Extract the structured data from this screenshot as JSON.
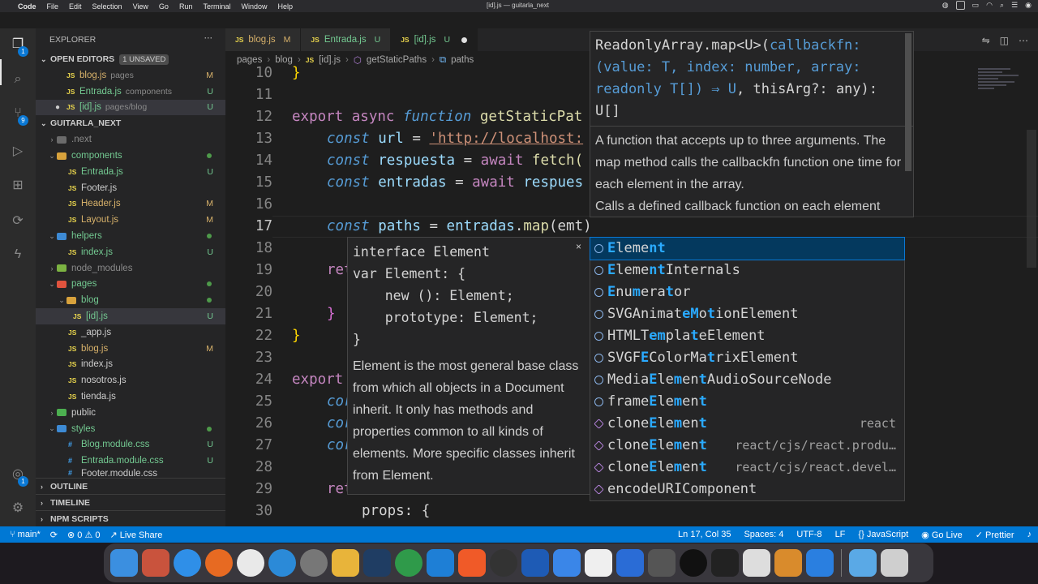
{
  "menubar": {
    "app": "Code",
    "items": [
      "File",
      "Edit",
      "Selection",
      "View",
      "Go",
      "Run",
      "Terminal",
      "Window",
      "Help"
    ],
    "window_title": "[id].js — guitarla_next"
  },
  "activity": {
    "source_control_badge": "9",
    "accounts_badge": "1",
    "explorer_badge": "1"
  },
  "sidebar": {
    "title": "EXPLORER",
    "open_editors": {
      "label": "OPEN EDITORS",
      "badge": "1 UNSAVED"
    },
    "open_files": [
      {
        "name": "blog.js",
        "path": "pages",
        "status": "M"
      },
      {
        "name": "Entrada.js",
        "path": "components",
        "status": "U"
      },
      {
        "name": "[id].js",
        "path": "pages/blog",
        "status": "U"
      }
    ],
    "project": "GUITARLA_NEXT",
    "tree": {
      "next": ".next",
      "components": "components",
      "entrada": "Entrada.js",
      "footer": "Footer.js",
      "header": "Header.js",
      "layout": "Layout.js",
      "helpers": "helpers",
      "index_helpers": "index.js",
      "node_modules": "node_modules",
      "pages": "pages",
      "blog_folder": "blog",
      "id_js": "[id].js",
      "app_js": "_app.js",
      "blog_js": "blog.js",
      "index_js": "index.js",
      "nosotros": "nosotros.js",
      "tienda": "tienda.js",
      "public": "public",
      "styles": "styles",
      "blog_css": "Blog.module.css",
      "entrada_css": "Entrada.module.css",
      "footer_css": "Footer.module.css"
    },
    "status": {
      "u": "U",
      "m": "M"
    },
    "outline": "OUTLINE",
    "timeline": "TIMELINE",
    "npm": "NPM SCRIPTS"
  },
  "tabs": [
    {
      "label": "blog.js",
      "status": "M"
    },
    {
      "label": "Entrada.js",
      "status": "U"
    },
    {
      "label": "[id].js",
      "status": "U"
    }
  ],
  "breadcrumbs": {
    "a": "pages",
    "b": "blog",
    "c": "[id].js",
    "d": "getStaticPaths",
    "e": "paths"
  },
  "editor": {
    "line_numbers": [
      "10",
      "11",
      "12",
      "13",
      "14",
      "15",
      "16",
      "17",
      "18",
      "19",
      "20",
      "21",
      "22",
      "23",
      "24",
      "25",
      "26",
      "27",
      "28",
      "29",
      "30"
    ],
    "current_line": "17",
    "l12": {
      "kw1": "export",
      "kw2": "async",
      "kw3": "function",
      "fn": "getStaticPat"
    },
    "l13": {
      "kw": "const",
      "var": "url",
      "op": " = ",
      "str": "'http://localhost:"
    },
    "l14": {
      "kw": "const",
      "var": "respuesta",
      "op": " = ",
      "kw2": "await",
      "fn": "fetch("
    },
    "l15": {
      "kw": "const",
      "var": "entradas",
      "op": " = ",
      "kw2": "await",
      "var2": "respues"
    },
    "l17": {
      "kw": "const",
      "var": "paths",
      "op": " = ",
      "var2": "entradas",
      "dot": ".",
      "fn": "map",
      "rest": "(emt)"
    },
    "l19": {
      "kw": "ret"
    },
    "l21": {
      "brace": "}"
    },
    "l22": {
      "brace": "}"
    },
    "l24": {
      "kw": "export"
    },
    "l25": {
      "kw": "cor"
    },
    "l26": {
      "kw": "cor"
    },
    "l27": {
      "kw": "cor"
    },
    "l29": {
      "kw": "ret"
    },
    "l30": {
      "code": "props: {"
    },
    "l10": {
      "brace": "}"
    }
  },
  "signature_hover": {
    "code_line1": "ReadonlyArray.map<U>(",
    "code_param1": "callbackfn:",
    "code_param2": "(value: T, index: number, array:",
    "code_param3": "readonly T[]) ⇒ U",
    "code_rest": ", thisArg?: any):",
    "code_line4": "U[]",
    "doc1": "A function that accepts up to three arguments. The map method calls the callbackfn function one time for each element in the array.",
    "doc2": "Calls a defined callback function on each element"
  },
  "detail_hover": {
    "code": "interface Element\nvar Element: {\n    new (): Element;\n    prototype: Element;\n}",
    "doc": "Element is the most general base class from which all objects in a Document inherit. It only has methods and properties common to all kinds of elements. More specific classes inherit from Element.",
    "close": "×"
  },
  "suggestions": [
    {
      "parts": [
        [
          "E",
          "hl"
        ],
        [
          "l",
          ""
        ],
        [
          "e",
          ""
        ],
        [
          "m",
          ""
        ],
        [
          "e",
          ""
        ],
        [
          "nt",
          "hl"
        ]
      ],
      "detail": "",
      "icon": "class"
    },
    {
      "parts": [
        [
          "E",
          "hl"
        ],
        [
          "l",
          ""
        ],
        [
          "e",
          ""
        ],
        [
          "m",
          ""
        ],
        [
          "e",
          ""
        ],
        [
          "nt",
          "hl"
        ],
        [
          "Internals",
          ""
        ]
      ],
      "detail": "",
      "icon": "class"
    },
    {
      "parts": [
        [
          "E",
          "hl"
        ],
        [
          "nu",
          ""
        ],
        [
          "m",
          "hl"
        ],
        [
          "era",
          ""
        ],
        [
          "t",
          "hl"
        ],
        [
          "or",
          ""
        ]
      ],
      "detail": "",
      "icon": "class"
    },
    {
      "parts": [
        [
          "SVGAnimat",
          ""
        ],
        [
          "e",
          "hl"
        ],
        [
          "M",
          "hl"
        ],
        [
          "o",
          ""
        ],
        [
          "t",
          "hl"
        ],
        [
          "ionElement",
          ""
        ]
      ],
      "detail": "",
      "icon": "class"
    },
    {
      "parts": [
        [
          "HTMLT",
          ""
        ],
        [
          "e",
          "hl"
        ],
        [
          "m",
          "hl"
        ],
        [
          "pla",
          ""
        ],
        [
          "t",
          "hl"
        ],
        [
          "eElement",
          ""
        ]
      ],
      "detail": "",
      "icon": "class"
    },
    {
      "parts": [
        [
          "SVGF",
          ""
        ],
        [
          "E",
          "hl"
        ],
        [
          "ColorMa",
          ""
        ],
        [
          "t",
          "hl"
        ],
        [
          "rixElement",
          ""
        ]
      ],
      "detail": "",
      "icon": "class"
    },
    {
      "parts": [
        [
          "Media",
          ""
        ],
        [
          "E",
          "hl"
        ],
        [
          "le",
          ""
        ],
        [
          "m",
          "hl"
        ],
        [
          "en",
          ""
        ],
        [
          "t",
          "hl"
        ],
        [
          "AudioSourceNode",
          ""
        ]
      ],
      "detail": "",
      "icon": "class"
    },
    {
      "parts": [
        [
          "frame",
          ""
        ],
        [
          "E",
          "hl"
        ],
        [
          "le",
          ""
        ],
        [
          "m",
          "hl"
        ],
        [
          "en",
          ""
        ],
        [
          "t",
          "hl"
        ]
      ],
      "detail": "",
      "icon": "class"
    },
    {
      "parts": [
        [
          "clone",
          ""
        ],
        [
          "E",
          "hl"
        ],
        [
          "le",
          ""
        ],
        [
          "m",
          "hl"
        ],
        [
          "en",
          ""
        ],
        [
          "t",
          "hl"
        ]
      ],
      "detail": "react",
      "icon": "module"
    },
    {
      "parts": [
        [
          "clone",
          ""
        ],
        [
          "E",
          "hl"
        ],
        [
          "le",
          ""
        ],
        [
          "m",
          "hl"
        ],
        [
          "en",
          ""
        ],
        [
          "t",
          "hl"
        ]
      ],
      "detail": "react/cjs/react.produ…",
      "icon": "module"
    },
    {
      "parts": [
        [
          "clone",
          ""
        ],
        [
          "E",
          "hl"
        ],
        [
          "le",
          ""
        ],
        [
          "m",
          "hl"
        ],
        [
          "en",
          ""
        ],
        [
          "t",
          "hl"
        ]
      ],
      "detail": "react/cjs/react.devel…",
      "icon": "module"
    },
    {
      "parts": [
        [
          "encodeURIComponent",
          ""
        ]
      ],
      "detail": "",
      "icon": "module"
    }
  ],
  "statusbar": {
    "branch": "main*",
    "problems": "⊗ 0 ⚠ 0",
    "live_share": "Live Share",
    "position": "Ln 17, Col 35",
    "spaces": "Spaces: 4",
    "encoding": "UTF-8",
    "eol": "LF",
    "language": "JavaScript",
    "go_live": "Go Live",
    "prettier": "Prettier"
  },
  "colors": {
    "status_bar": "#0078d4",
    "accent": "#2aaaff"
  }
}
